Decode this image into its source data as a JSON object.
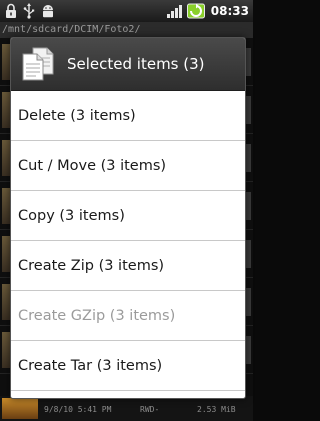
{
  "status_bar": {
    "icons_left": [
      "lock-icon",
      "usb-icon",
      "android-icon"
    ],
    "icons_right": [
      "signal-icon",
      "battery-charging-icon"
    ],
    "time": "08:33"
  },
  "background": {
    "path": "/mnt/sdcard/DCIM/Foto2/",
    "footer": {
      "date": "9/8/10 5:41 PM",
      "type": "RWD-",
      "size": "2.53 MiB"
    }
  },
  "dialog": {
    "icon": "files-icon",
    "title": "Selected items (3)",
    "items": [
      {
        "label": "Delete (3 items)",
        "enabled": true
      },
      {
        "label": "Cut / Move (3 items)",
        "enabled": true
      },
      {
        "label": "Copy (3 items)",
        "enabled": true
      },
      {
        "label": "Create Zip (3 items)",
        "enabled": true
      },
      {
        "label": "Create GZip (3 items)",
        "enabled": false
      },
      {
        "label": "Create Tar (3 items)",
        "enabled": true
      }
    ]
  },
  "colors": {
    "dialog_header": "#3a3a3a",
    "item_text": "#1a1a1a",
    "disabled_text": "#9b9b9b",
    "battery_accent": "#8ad02a"
  }
}
